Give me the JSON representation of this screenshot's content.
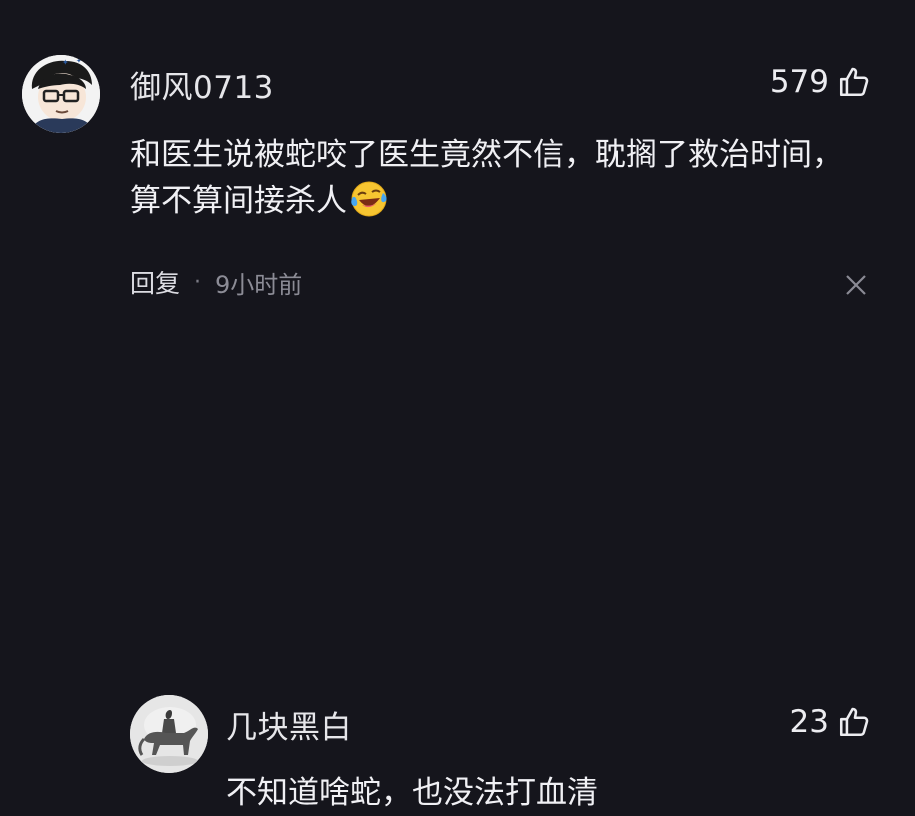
{
  "comments": [
    {
      "username": "御风0713",
      "likes": "579",
      "text": "和医生说被蛇咬了医生竟然不信，耽搁了救治时间，算不算间接杀人",
      "emoji": "rolling-on-floor-laughing-emoji",
      "reply_label": "回复",
      "separator": "·",
      "time": "9小时前"
    },
    {
      "username": "几块黑白",
      "likes": "23",
      "text": "不知道啥蛇，也没法打血清"
    }
  ],
  "icons": {
    "like": "thumbs-up-icon",
    "close": "close-icon"
  },
  "colors": {
    "background": "#15151c",
    "text": "#f0f0f4",
    "muted": "#8c8c96"
  }
}
